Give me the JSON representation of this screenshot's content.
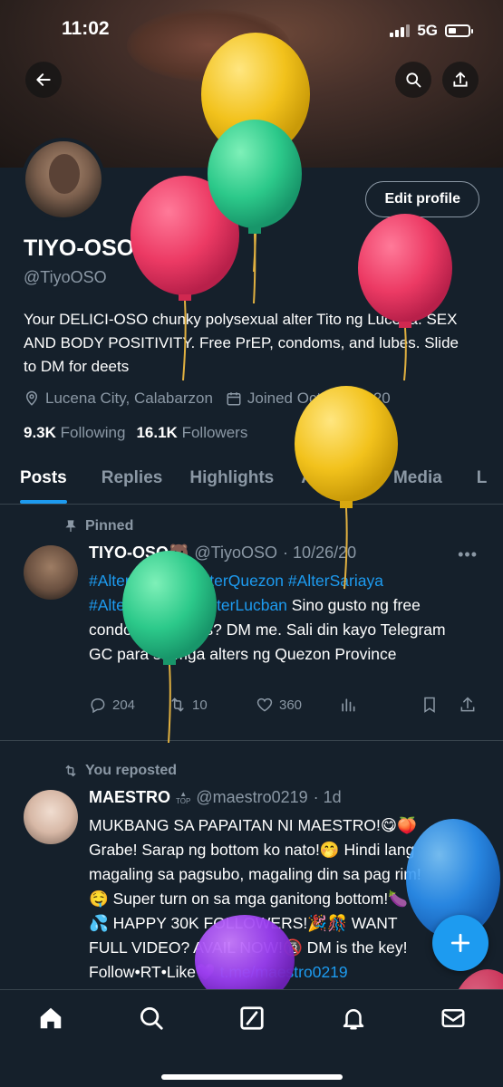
{
  "status_bar": {
    "time": "11:02",
    "network": "5G"
  },
  "profile": {
    "name": "TIYO-OSO",
    "name_emoji": "🐻",
    "handle": "@TiyoOSO",
    "edit_button": "Edit profile",
    "bio": "Your DELICI-OSO chunky polysexual alter Tito ng Lucena. SEX AND BODY POSITIVITY. Free PrEP, condoms, and lubes. Slide to DM for deets",
    "location": "Lucena City, Calabarzon",
    "joined": "Joined October 2020",
    "following_count": "9.3K",
    "following_label": "Following",
    "followers_count": "16.1K",
    "followers_label": "Followers"
  },
  "tabs": [
    "Posts",
    "Replies",
    "Highlights",
    "Articles",
    "Media",
    "L"
  ],
  "tweets": [
    {
      "context": "Pinned",
      "name": "TIYO-OSO🐻",
      "handle": "@TiyoOSO",
      "date": "· 10/26/20",
      "tags": [
        "#AlterLucena",
        "#AlterQuezon",
        "#AlterSariaya",
        "#AlterTayabas",
        "#AlterLucban"
      ],
      "text": "Sino gusto ng free condoms at lubes? DM me. Sali din kayo Telegram GC para sa mga alters ng Quezon Province",
      "replies": "204",
      "reposts": "10",
      "likes": "360"
    },
    {
      "context": "You reposted",
      "name": "MAESTRO",
      "badge": "TOP",
      "handle": "@maestro0219",
      "date": "· 1d",
      "text_lines": [
        "MUKBANG SA PAPAITAN NI MAESTRO!😋🍑",
        "Grabe! Sarap ng bottom ko nato!🤭 Hindi lang",
        "magaling sa pagsubo, magaling din sa pag rim!",
        "🤤 Super turn on sa mga ganitong bottom!🍆",
        "💦 HAPPY 30K FOLLOWERS!🎉🎊 WANT",
        "FULL VIDEO? AVAIL NOW!🔞 DM is the key!"
      ],
      "last_line_prefix": "Follow•RT•Like💜",
      "link": "t.me/maestro0219"
    }
  ],
  "colors": {
    "accent": "#1d9bf0",
    "background": "#15202b",
    "muted": "#8b98a5",
    "divider": "#38444d"
  },
  "nav_icons": [
    "home-icon",
    "search-icon",
    "grok-icon",
    "bell-icon",
    "mail-icon"
  ]
}
